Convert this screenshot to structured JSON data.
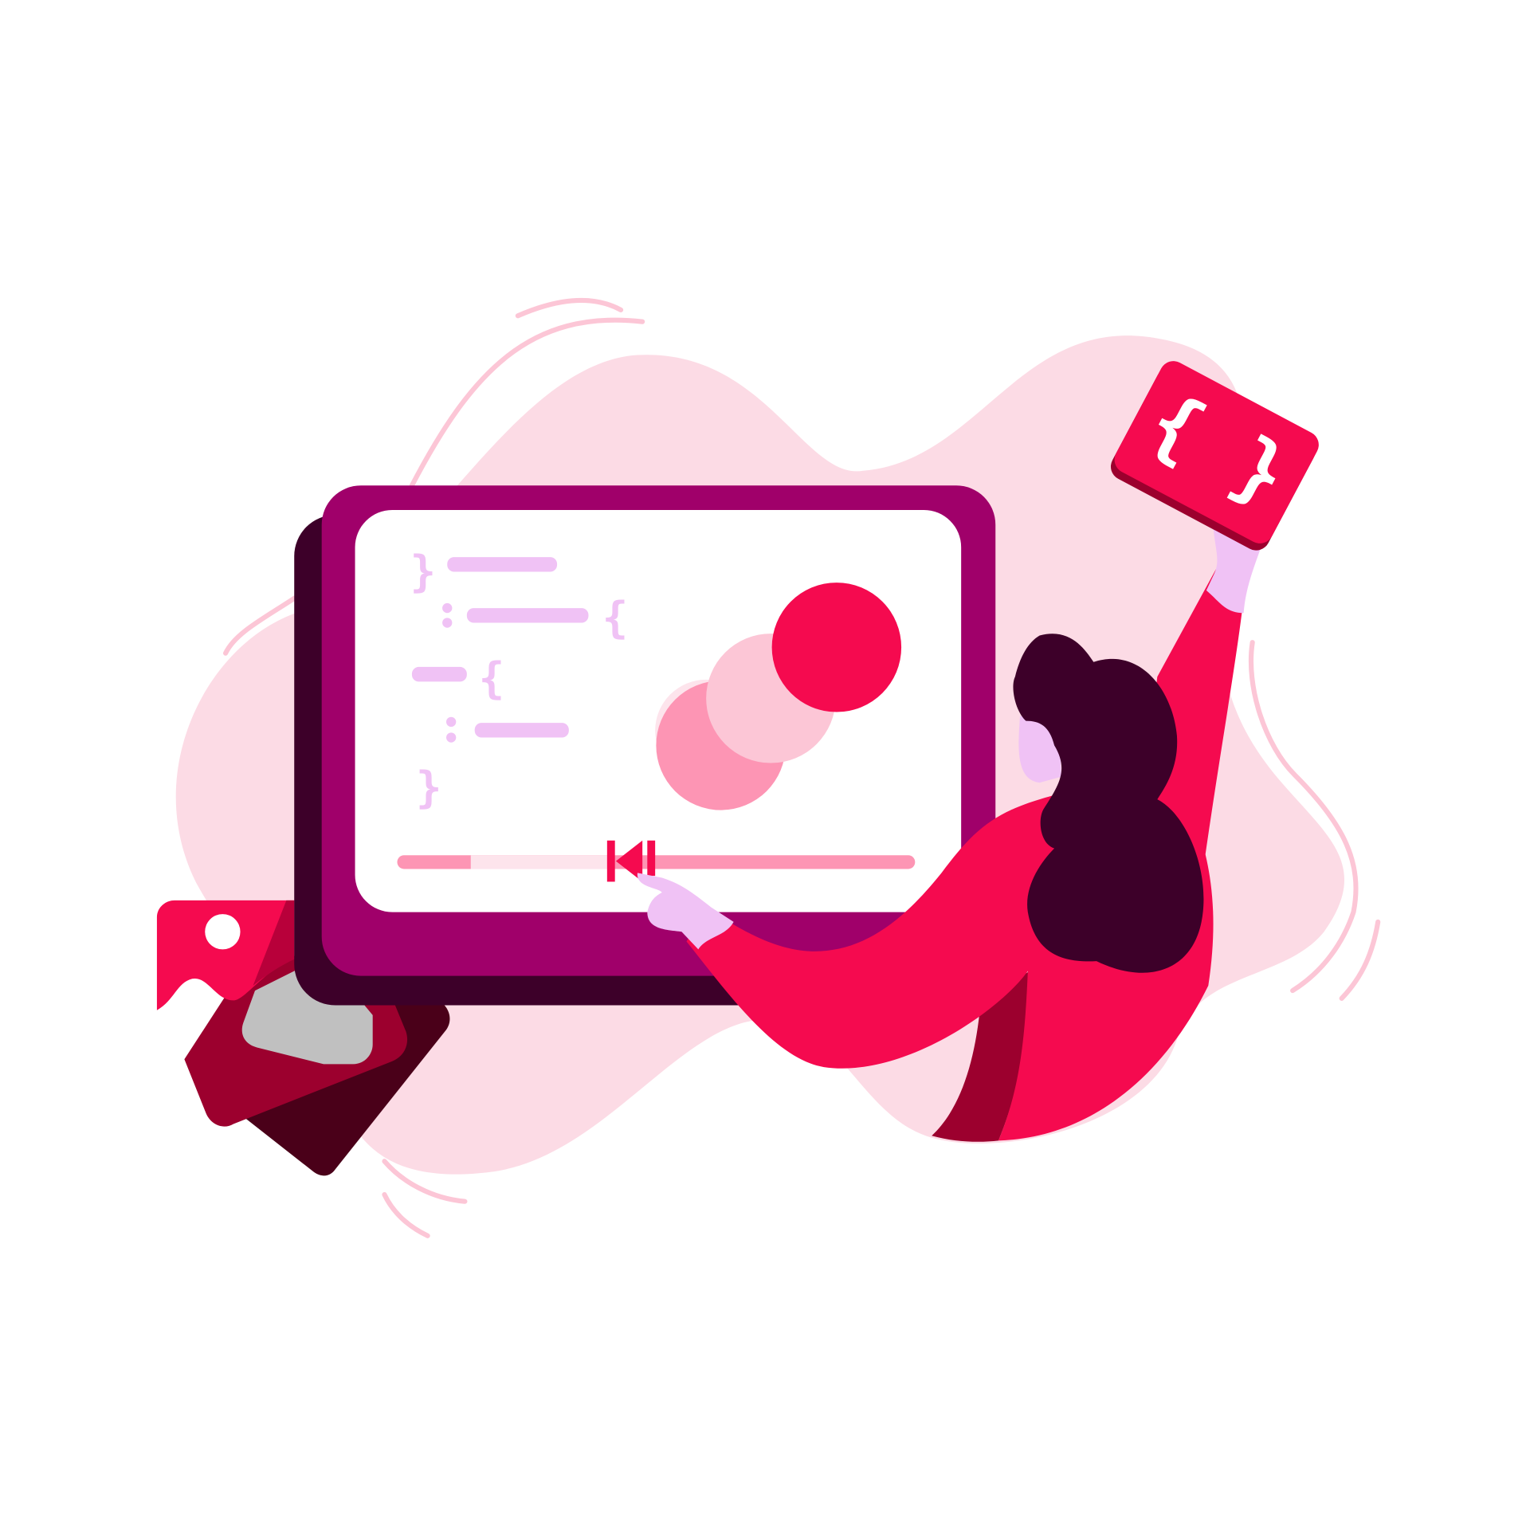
{
  "illustration": {
    "subject": "person-interacting-with-code-video-player",
    "code_braces": "{ }",
    "colors": {
      "background": "#ffffff",
      "blob": "#fcdbe5",
      "accent_red": "#f50a4f",
      "monitor_front": "#a0006a",
      "monitor_back": "#3d0029",
      "lavender": "#f0c2f5",
      "pink_mid": "#fd95b4",
      "pink_light": "#fcc6d6",
      "dark_red": "#9c002e",
      "grey": "#c0c0c0"
    },
    "icons": [
      "skip-back-icon",
      "pause-icon",
      "image-icon",
      "code-braces-icon"
    ],
    "progress": 0.4
  }
}
